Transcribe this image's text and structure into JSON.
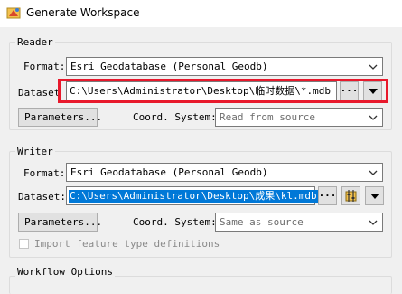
{
  "window": {
    "title": "Generate Workspace"
  },
  "reader": {
    "group_label": "Reader",
    "format_label": "Format:",
    "format_value": "Esri Geodatabase (Personal Geodb)",
    "dataset_label": "Dataset",
    "dataset_value": "C:\\Users\\Administrator\\Desktop\\临时数据\\*.mdb",
    "browse_label": "···",
    "parameters_label": "Parameters...",
    "coord_label": "Coord. System:",
    "coord_value": "Read from source"
  },
  "writer": {
    "group_label": "Writer",
    "format_label": "Format:",
    "format_value": "Esri Geodatabase (Personal Geodb)",
    "dataset_label": "Dataset:",
    "dataset_value": "C:\\Users\\Administrator\\Desktop\\成果\\kl.mdb",
    "browse_label": "···",
    "parameters_label": "Parameters...",
    "coord_label": "Coord. System:",
    "coord_value": "Same as source",
    "import_label": "Import feature type definitions"
  },
  "workflow": {
    "group_label": "Workflow Options"
  },
  "colors": {
    "highlight_border": "#e8192c",
    "selection": "#0078d7"
  }
}
